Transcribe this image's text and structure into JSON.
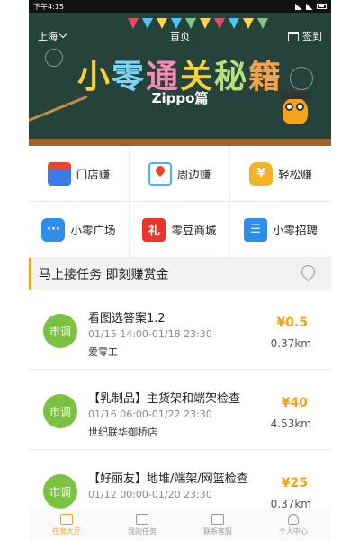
{
  "status_bar": {
    "time": "下午4:15"
  },
  "header": {
    "city": "上海",
    "title": "首页",
    "signin_label": "签到"
  },
  "banner": {
    "title_chars": [
      "小",
      "零",
      "通",
      "关",
      "秘",
      "籍"
    ],
    "title_colors": [
      "#f7d13a",
      "#7cd4f7",
      "#f58ab5",
      "#f7d13a",
      "#b7e27a",
      "#f7a24a"
    ],
    "subtitle": "Zippo篇"
  },
  "grid": [
    {
      "label": "门店赚",
      "icon": "shop-icon"
    },
    {
      "label": "周边赚",
      "icon": "map-pin-icon"
    },
    {
      "label": "轻松赚",
      "icon": "money-bag-icon",
      "glyph": "¥"
    },
    {
      "label": "小零广场",
      "icon": "chat-icon",
      "glyph": "···"
    },
    {
      "label": "零豆商城",
      "icon": "gift-icon",
      "glyph": "礼"
    },
    {
      "label": "小零招聘",
      "icon": "id-card-icon",
      "glyph": "☰"
    }
  ],
  "section": {
    "title": "马上接任务 即刻赚赏金"
  },
  "tasks": [
    {
      "badge": "市调",
      "title": "看图选答案1.2",
      "time": "01/15 14:00-01/18 23:30",
      "place": "爱零工",
      "price": "¥0.5",
      "distance": "0.37km"
    },
    {
      "badge": "市调",
      "title": "【乳制品】主货架和端架检查",
      "time": "01/16 06:00-01/22 23:30",
      "place": "世纪联华御桥店",
      "price": "¥40",
      "distance": "4.53km"
    },
    {
      "badge": "市调",
      "title": "【好丽友】地堆/端架/网篮检查",
      "time": "01/12 00:00-01/20 23:30",
      "place": "",
      "price": "¥25",
      "distance": "0.37km"
    }
  ],
  "bottom_nav": [
    {
      "label": "任务大厅",
      "icon": "book-icon",
      "active": true
    },
    {
      "label": "我的任务",
      "icon": "list-icon",
      "active": false
    },
    {
      "label": "联系客服",
      "icon": "message-icon",
      "active": false
    },
    {
      "label": "个人中心",
      "icon": "person-icon",
      "active": false
    }
  ],
  "colors": {
    "accent": "#f0a21b",
    "badge_green": "#7cc241",
    "banner_bg": "#25433a"
  }
}
